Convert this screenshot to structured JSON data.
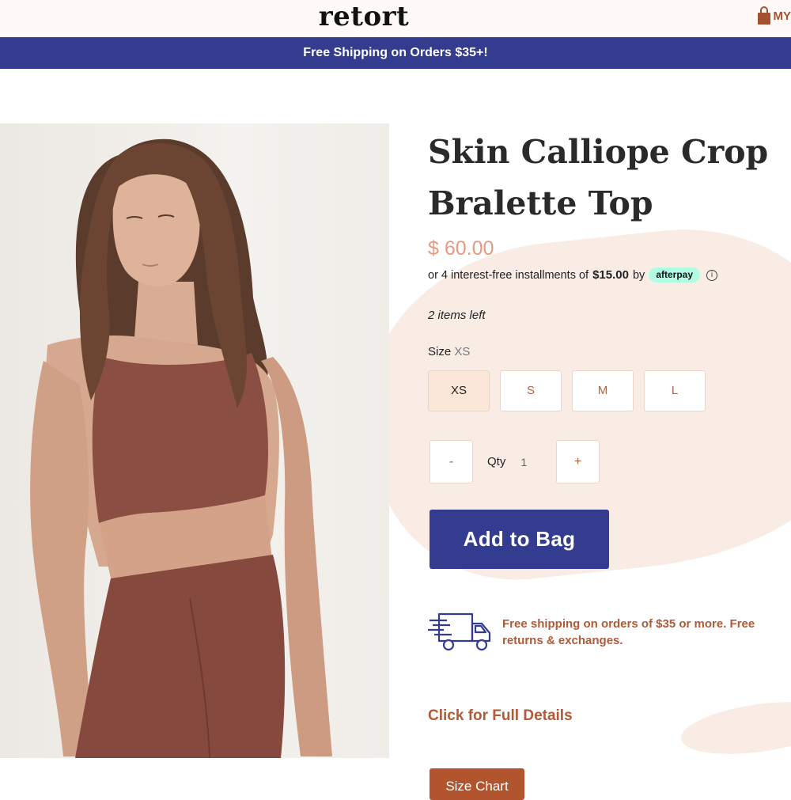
{
  "header": {
    "logo": "retort",
    "account_label": "MY"
  },
  "banner": {
    "text": "Free Shipping on Orders $35+!"
  },
  "product": {
    "title": "Skin Calliope Crop Bralette Top",
    "price": "$ 60.00",
    "installments": {
      "prefix": "or 4 interest-free installments of",
      "amount": "$15.00",
      "by": "by",
      "provider": "afterpay",
      "info_glyph": "i"
    },
    "stock": "2 items left",
    "size": {
      "label": "Size",
      "selected": "XS",
      "options": [
        "XS",
        "S",
        "M",
        "L"
      ]
    },
    "quantity": {
      "minus": "-",
      "label": "Qty",
      "value": "1",
      "plus": "+"
    },
    "add_to_bag": "Add to Bag",
    "shipping_note": "Free shipping on orders of $35 or more. Free returns & exchanges.",
    "details_link": "Click for Full Details",
    "size_chart": "Size Chart"
  },
  "colors": {
    "brand_navy": "#343c8f",
    "accent_rust": "#b05a37",
    "price_peach": "#e49a7f",
    "selected_size_bg": "#fae7d8",
    "afterpay_mint": "#b2fce4"
  },
  "icons": [
    "shopping-bag-icon",
    "info-icon",
    "delivery-truck-icon"
  ]
}
